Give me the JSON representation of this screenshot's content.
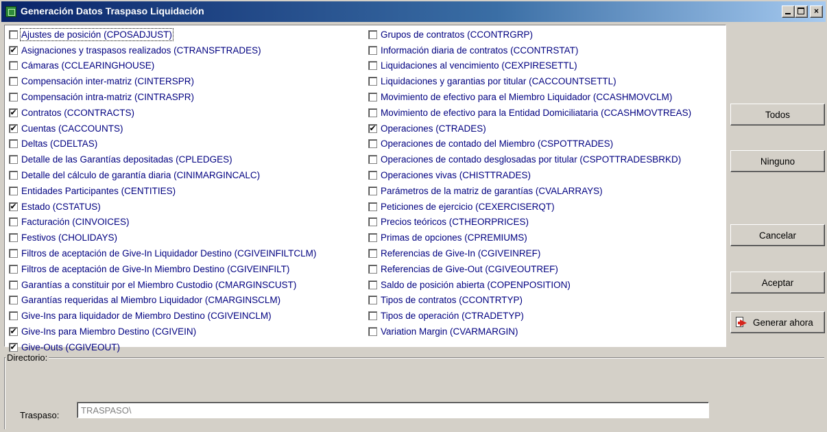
{
  "window": {
    "title": "Generación Datos Traspaso Liquidación",
    "controls": {
      "minimize": "_",
      "maximize": "□",
      "close": "×"
    }
  },
  "check_mark": "✔",
  "left_items": [
    {
      "label": "Ajustes de posición (CPOSADJUST)",
      "checked": false,
      "focused": true
    },
    {
      "label": "Asignaciones y traspasos realizados (CTRANSFTRADES)",
      "checked": true
    },
    {
      "label": "Cámaras (CCLEARINGHOUSE)",
      "checked": false
    },
    {
      "label": "Compensación inter-matriz (CINTERSPR)",
      "checked": false
    },
    {
      "label": "Compensación intra-matriz (CINTRASPR)",
      "checked": false
    },
    {
      "label": "Contratos (CCONTRACTS)",
      "checked": true
    },
    {
      "label": "Cuentas (CACCOUNTS)",
      "checked": true
    },
    {
      "label": "Deltas (CDELTAS)",
      "checked": false
    },
    {
      "label": "Detalle de las Garantías depositadas (CPLEDGES)",
      "checked": false
    },
    {
      "label": "Detalle del cálculo de garantía diaria (CINIMARGINCALC)",
      "checked": false
    },
    {
      "label": "Entidades Participantes (CENTITIES)",
      "checked": false
    },
    {
      "label": "Estado (CSTATUS)",
      "checked": true
    },
    {
      "label": "Facturación (CINVOICES)",
      "checked": false
    },
    {
      "label": "Festivos (CHOLIDAYS)",
      "checked": false
    },
    {
      "label": "Filtros de aceptación de Give-In Liquidador Destino (CGIVEINFILTCLM)",
      "checked": false
    },
    {
      "label": "Filtros de aceptación de Give-In Miembro Destino (CGIVEINFILT)",
      "checked": false
    },
    {
      "label": "Garantías a constituir por el Miembro Custodio (CMARGINSCUST)",
      "checked": false
    },
    {
      "label": "Garantías requeridas al Miembro Liquidador (CMARGINSCLM)",
      "checked": false
    },
    {
      "label": "Give-Ins para liquidador de Miembro Destino (CGIVEINCLM)",
      "checked": false
    },
    {
      "label": "Give-Ins para Miembro Destino (CGIVEIN)",
      "checked": true
    },
    {
      "label": "Give-Outs (CGIVEOUT)",
      "checked": true
    }
  ],
  "right_items": [
    {
      "label": "Grupos de contratos (CCONTRGRP)",
      "checked": false
    },
    {
      "label": "Información diaria de contratos (CCONTRSTAT)",
      "checked": false
    },
    {
      "label": "Liquidaciones al vencimiento (CEXPIRESETTL)",
      "checked": false
    },
    {
      "label": "Liquidaciones y garantias por titular (CACCOUNTSETTL)",
      "checked": false
    },
    {
      "label": "Movimiento de efectivo para el Miembro Liquidador (CCASHMOVCLM)",
      "checked": false
    },
    {
      "label": "Movimiento de efectivo para la Entidad Domiciliataria (CCASHMOVTREAS)",
      "checked": false
    },
    {
      "label": "Operaciones (CTRADES)",
      "checked": true
    },
    {
      "label": "Operaciones de contado del Miembro (CSPOTTRADES)",
      "checked": false
    },
    {
      "label": "Operaciones de contado desglosadas por titular (CSPOTTRADESBRKD)",
      "checked": false
    },
    {
      "label": "Operaciones vivas (CHISTTRADES)",
      "checked": false
    },
    {
      "label": "Parámetros de la matriz de garantías (CVALARRAYS)",
      "checked": false
    },
    {
      "label": "Peticiones de ejercicio (CEXERCISERQT)",
      "checked": false
    },
    {
      "label": "Precios teóricos (CTHEORPRICES)",
      "checked": false
    },
    {
      "label": "Primas de opciones (CPREMIUMS)",
      "checked": false
    },
    {
      "label": "Referencias de Give-In (CGIVEINREF)",
      "checked": false
    },
    {
      "label": "Referencias de Give-Out (CGIVEOUTREF)",
      "checked": false
    },
    {
      "label": "Saldo de posición abierta (COPENPOSITION)",
      "checked": false
    },
    {
      "label": "Tipos de contratos (CCONTRTYP)",
      "checked": false
    },
    {
      "label": "Tipos de operación (CTRADETYP)",
      "checked": false
    },
    {
      "label": "Variation Margin (CVARMARGIN)",
      "checked": false
    }
  ],
  "buttons": {
    "todos": "Todos",
    "ninguno": "Ninguno",
    "cancelar": "Cancelar",
    "aceptar": "Aceptar",
    "generar": "Generar ahora"
  },
  "directory": {
    "group_label": "Directorio:",
    "traspaso_label": "Traspaso:",
    "traspaso_value": "TRASPASO\\"
  },
  "colors": {
    "item_text": "#000080",
    "title_gradient_start": "#0a246a",
    "title_gradient_end": "#a6caf0",
    "face": "#d4d0c8"
  }
}
